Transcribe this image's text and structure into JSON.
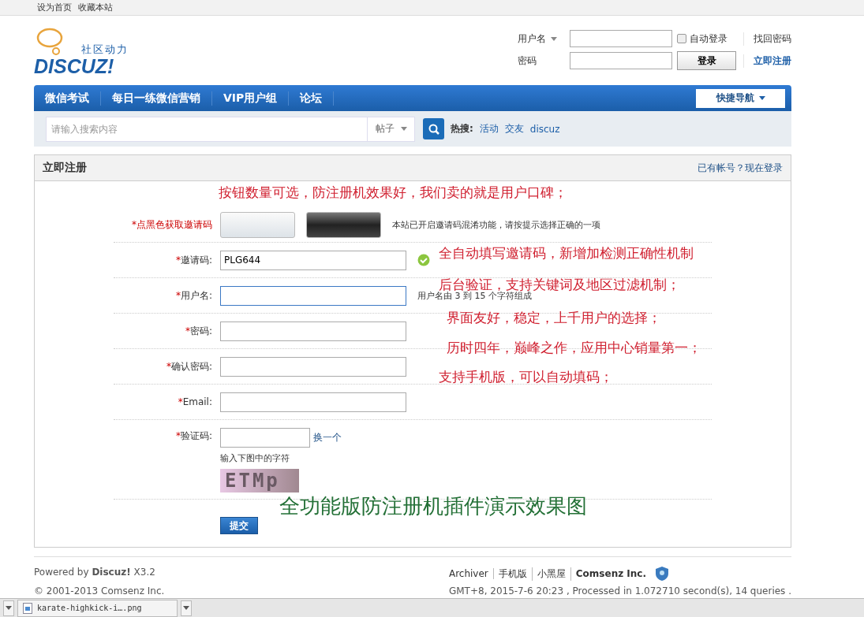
{
  "topbar": {
    "links": [
      "设为首页",
      "收藏本站"
    ]
  },
  "logo": {
    "slogan": "社区动力",
    "wordmark": "DISCUZ!"
  },
  "login": {
    "username_label": "用户名",
    "password_label": "密码",
    "auto_login": {
      "label": "自动登录",
      "checked": false
    },
    "submit": "登录",
    "forgot": "找回密码",
    "register": "立即注册"
  },
  "nav": {
    "items": [
      "微信考试",
      "每日一练微信营销",
      "VIP用户组",
      "论坛"
    ],
    "quick_nav": "快捷导航"
  },
  "search": {
    "placeholder": "请输入搜索内容",
    "scope": "帖子",
    "hot_label": "热搜:",
    "hot": [
      "活动",
      "交友",
      "discuz"
    ]
  },
  "register": {
    "title": "立即注册",
    "login_link": "已有帐号？现在登录",
    "invite_picker": {
      "label": "*点黑色获取邀请码",
      "hint": "本站已开启邀请码混淆功能，请按提示选择正确的一项"
    },
    "fields": [
      {
        "kind": "text",
        "required_mark": "*",
        "label": "邀请码:",
        "value": "PLG644",
        "focused": false,
        "valid": true
      },
      {
        "kind": "text",
        "required_mark": "*",
        "label": "用户名:",
        "focused": true,
        "hint": "用户名由 3 到 15 个字符组成"
      },
      {
        "kind": "text",
        "required_mark": "*",
        "label": "密码:",
        "focused": false
      },
      {
        "kind": "text",
        "required_mark": "*",
        "label": "确认密码:",
        "focused": false
      },
      {
        "kind": "text",
        "required_mark": "*",
        "label": "Email:",
        "focused": false
      },
      {
        "kind": "captcha",
        "required_mark": "*",
        "label": "验证码:",
        "refresh": "换一个",
        "instruction": "输入下图中的字符",
        "captcha_text": "ETMp"
      }
    ],
    "submit": "提交",
    "annotations": [
      "按钮数量可选，防注册机效果好，我们卖的就是用户口碑；",
      "全自动填写邀请码，新增加检测正确性机制",
      "后台验证，支持关键词及地区过滤机制；",
      "界面友好，稳定，上千用户的选择；",
      "历时四年，巅峰之作，应用中心销量第一；",
      "支持手机版，可以自动填码；"
    ],
    "caption": "全功能版防注册机插件演示效果图"
  },
  "footer": {
    "powered": "Powered by **Discuz!** X3.2",
    "copyright": "© 2001-2013 Comsenz Inc.",
    "links": [
      "Archiver",
      "手机版",
      "小黑屋",
      "Comsenz Inc."
    ],
    "stats": "GMT+8, 2015-7-6 20:23 , Processed in 1.072710 second(s), 14 queries ."
  },
  "download_bar": {
    "file": "karate-highkick-i….png"
  }
}
